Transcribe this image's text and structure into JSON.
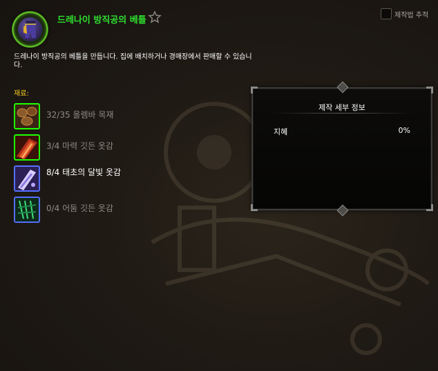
{
  "recipe": {
    "title": "드레나이 방직공의 베틀",
    "icon": "purple-pants-icon",
    "favorite_icon": "star-outline-icon",
    "description": "드레나이 방직공의 베틀을 만듭니다. 집에 배치하거나 경매장에서 판매할 수 있습니다.",
    "track_label": "제작법 추적",
    "track_checked": false
  },
  "reagents": {
    "label": "재료:",
    "items": [
      {
        "count": "32/35",
        "name": "올렘바 목재",
        "icon": "wood-logs-icon",
        "quality": "uncommon",
        "enough": false
      },
      {
        "count": "3/4",
        "name": "마력 깃든 옷감",
        "icon": "red-cloth-icon",
        "quality": "uncommon",
        "enough": false
      },
      {
        "count": "8/4",
        "name": "태초의 달빛 옷감",
        "icon": "moonlight-cloth-icon",
        "quality": "rare",
        "enough": true
      },
      {
        "count": "0/4",
        "name": "어둠 깃든 옷감",
        "icon": "shadow-cloth-icon",
        "quality": "rare",
        "enough": false
      }
    ]
  },
  "details": {
    "title": "제작 세부 정보",
    "stat_name": "지혜",
    "stat_value": "0%"
  },
  "colors": {
    "title_green": "#2ee02e",
    "reagent_label_gold": "#f3c91e",
    "uncommon_border": "#1eff00",
    "rare_border": "#5570ff"
  }
}
